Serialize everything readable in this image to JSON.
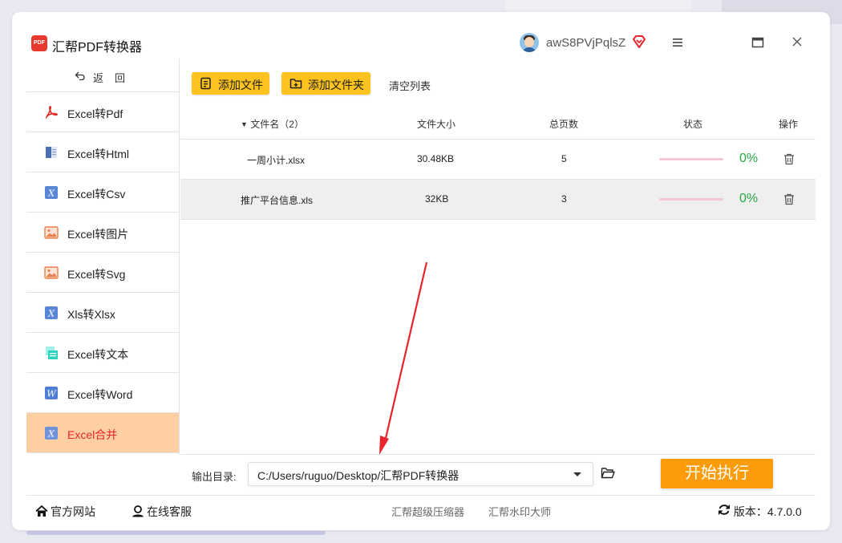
{
  "app": {
    "logo_text": "PDF",
    "title": "汇帮PDF转换器"
  },
  "user": {
    "name": "awS8PVjPqlsZ"
  },
  "sidebar": {
    "back_label": "返回",
    "items": [
      {
        "label": "Excel转Pdf",
        "icon": "pdf-icon"
      },
      {
        "label": "Excel转Html",
        "icon": "html-icon"
      },
      {
        "label": "Excel转Csv",
        "icon": "excel-icon"
      },
      {
        "label": "Excel转图片",
        "icon": "image-icon"
      },
      {
        "label": "Excel转Svg",
        "icon": "image-icon"
      },
      {
        "label": "Xls转Xlsx",
        "icon": "excel-icon"
      },
      {
        "label": "Excel转文本",
        "icon": "text-icon"
      },
      {
        "label": "Excel转Word",
        "icon": "word-icon"
      },
      {
        "label": "Excel合并",
        "icon": "excel-icon",
        "active": true
      }
    ]
  },
  "toolbar": {
    "add_file": "添加文件",
    "add_folder": "添加文件夹",
    "clear_list": "清空列表"
  },
  "table": {
    "columns": {
      "name": "文件名（2）",
      "size": "文件大小",
      "pages": "总页数",
      "status": "状态",
      "action": "操作"
    },
    "rows": [
      {
        "name": "一周小计.xlsx",
        "size": "30.48KB",
        "pages": "5",
        "progress": 0,
        "percent": "0%"
      },
      {
        "name": "推广平台信息.xls",
        "size": "32KB",
        "pages": "3",
        "progress": 0,
        "percent": "0%"
      }
    ]
  },
  "output": {
    "label": "输出目录:",
    "path": "C:/Users/ruguo/Desktop/汇帮PDF转换器",
    "start_button": "开始执行"
  },
  "statusbar": {
    "official_site": "官方网站",
    "online_service": "在线客服",
    "link1": "汇帮超级压缩器",
    "link2": "汇帮水印大师",
    "version_label": "版本：",
    "version": "4.7.0.0"
  },
  "colors": {
    "accent_yellow": "#fcc21d",
    "start_orange": "#fc9c0a",
    "active_nav_bg": "#ffcfa4",
    "active_nav_text": "#e8242d",
    "progress_green": "#2aa744"
  }
}
